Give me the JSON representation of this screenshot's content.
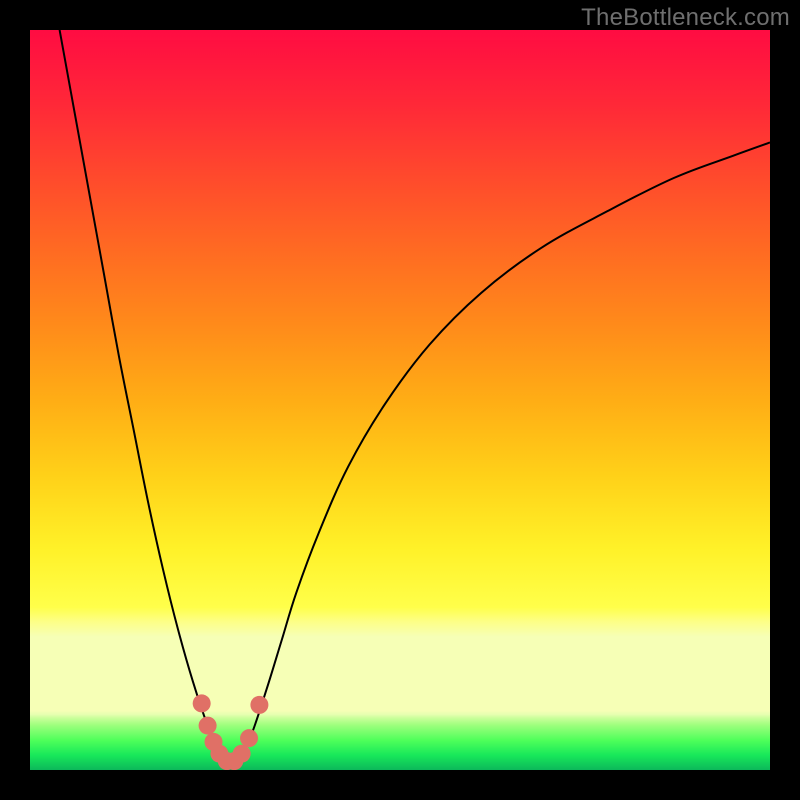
{
  "watermark": "TheBottleneck.com",
  "gradient": {
    "stops": [
      {
        "offset": 0.0,
        "color": "#ff0c42"
      },
      {
        "offset": 0.1,
        "color": "#ff2838"
      },
      {
        "offset": 0.2,
        "color": "#ff4a2c"
      },
      {
        "offset": 0.3,
        "color": "#ff6b22"
      },
      {
        "offset": 0.4,
        "color": "#ff8b1a"
      },
      {
        "offset": 0.5,
        "color": "#ffad15"
      },
      {
        "offset": 0.6,
        "color": "#ffd018"
      },
      {
        "offset": 0.7,
        "color": "#fff128"
      },
      {
        "offset": 0.78,
        "color": "#ffff4a"
      },
      {
        "offset": 0.8,
        "color": "#fdff88"
      },
      {
        "offset": 0.82,
        "color": "#f6ffb6"
      },
      {
        "offset": 0.92,
        "color": "#f6ffb6"
      },
      {
        "offset": 0.925,
        "color": "#e6ffb0"
      },
      {
        "offset": 0.93,
        "color": "#c9ff9a"
      },
      {
        "offset": 0.94,
        "color": "#9bff7c"
      },
      {
        "offset": 0.96,
        "color": "#4eff5a"
      },
      {
        "offset": 0.98,
        "color": "#18e85a"
      },
      {
        "offset": 1.0,
        "color": "#0cb85a"
      }
    ]
  },
  "chart_data": {
    "type": "line",
    "title": "",
    "xlabel": "",
    "ylabel": "",
    "xlim": [
      0,
      1
    ],
    "ylim": [
      0,
      1
    ],
    "description": "Bottleneck curve: y is mismatch (0=balanced/green, 1=max/red). Single V-shaped curve with minimum near x≈0.27. Left branch starts at top-left (severe bottleneck when x is low), right branch rises asymptotically toward ~0.85 on the right.",
    "series": [
      {
        "name": "bottleneck-curve",
        "x": [
          0.04,
          0.06,
          0.08,
          0.1,
          0.12,
          0.14,
          0.16,
          0.18,
          0.2,
          0.22,
          0.24,
          0.255,
          0.27,
          0.285,
          0.3,
          0.32,
          0.34,
          0.36,
          0.39,
          0.43,
          0.48,
          0.54,
          0.61,
          0.69,
          0.78,
          0.87,
          0.95,
          1.0
        ],
        "y": [
          1.0,
          0.89,
          0.78,
          0.67,
          0.56,
          0.46,
          0.36,
          0.27,
          0.19,
          0.12,
          0.06,
          0.025,
          0.01,
          0.02,
          0.05,
          0.11,
          0.175,
          0.24,
          0.32,
          0.41,
          0.495,
          0.575,
          0.645,
          0.705,
          0.755,
          0.8,
          0.83,
          0.848
        ]
      }
    ],
    "markers": {
      "name": "highlighted-points",
      "color": "#e07066",
      "points": [
        {
          "x": 0.232,
          "y": 0.09
        },
        {
          "x": 0.24,
          "y": 0.06
        },
        {
          "x": 0.248,
          "y": 0.038
        },
        {
          "x": 0.256,
          "y": 0.022
        },
        {
          "x": 0.266,
          "y": 0.012
        },
        {
          "x": 0.276,
          "y": 0.012
        },
        {
          "x": 0.286,
          "y": 0.022
        },
        {
          "x": 0.296,
          "y": 0.043
        },
        {
          "x": 0.31,
          "y": 0.088
        }
      ]
    }
  }
}
